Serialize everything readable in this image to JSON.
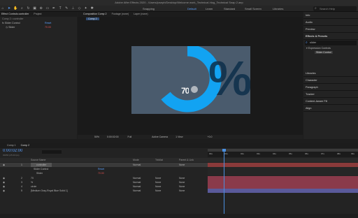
{
  "app": {
    "title": "Adobe After Effects 2020 - /Users/joseph/Desktop/Welcome work_Technical /dog_Technical Snap 2.aep"
  },
  "workspaces": [
    "Snapping",
    "Default",
    "Learn",
    "Standard",
    "Small Screen",
    "Libraries"
  ],
  "search_placeholder": "Search Help",
  "left_panel": {
    "tabs": [
      "Effect Controls controller",
      "Project"
    ],
    "comp_path": "Comp 2 • controller",
    "effect_name": "Slider Control",
    "reset": "Reset",
    "slider_label": "Slider",
    "slider_value": "70.00"
  },
  "comp_panel": {
    "tabs": [
      "Composition Comp 2",
      "Footage (none)",
      "Layer (none)"
    ],
    "sub_tab": "Comp 2",
    "zoom": "50%",
    "time": "0:00:02:00",
    "resolution": "Full",
    "camera": "Active Camera",
    "view": "1 View",
    "offset": "+0.0"
  },
  "artwork": {
    "number_text": "70",
    "bg_color": "#4a5b6d",
    "accent": "#12a3f2"
  },
  "right_panel": {
    "items": [
      "Info",
      "Audio",
      "Preview",
      "Effects & Presets"
    ],
    "search_value": "slider",
    "tree_category": "Expression Controls",
    "tree_item": "Slider Control",
    "lower_items": [
      "Libraries",
      "Character",
      "Paragraph",
      "Tracker",
      "Content-Aware Fill",
      "Align"
    ]
  },
  "timeline": {
    "tabs": [
      "Comp 1",
      "Comp 2"
    ],
    "timecode": "0:00:02:00",
    "frame_info": "00050 (25.00 fps)",
    "headers": {
      "source": "Source Name",
      "mode": "Mode",
      "trkmat": "TrkMat",
      "parent": "Parent & Link"
    },
    "layers": [
      {
        "num": "1",
        "name": "controller",
        "mode": "Normal",
        "trk": "",
        "parent": "None"
      },
      {
        "num": "",
        "name": "Slider Control",
        "mode": "",
        "trk": "",
        "parent": "Reset"
      },
      {
        "num": "",
        "name": "Slider",
        "mode": "",
        "trk": "",
        "parent": "70.00"
      },
      {
        "num": "2",
        "name": "70",
        "mode": "Normal",
        "trk": "None",
        "parent": "None"
      },
      {
        "num": "3",
        "name": "%",
        "mode": "Normal",
        "trk": "None",
        "parent": "None"
      },
      {
        "num": "4",
        "name": "circle",
        "mode": "Normal",
        "trk": "None",
        "parent": "None"
      },
      {
        "num": "5",
        "name": "[Medium Gray-Royal Blue Solid 1]",
        "mode": "Normal",
        "trk": "None",
        "parent": "None"
      }
    ],
    "ruler": [
      "00s",
      "01s",
      "02s",
      "03s",
      "04s",
      "05s",
      "06s",
      "07s",
      "08s",
      "09s"
    ]
  }
}
